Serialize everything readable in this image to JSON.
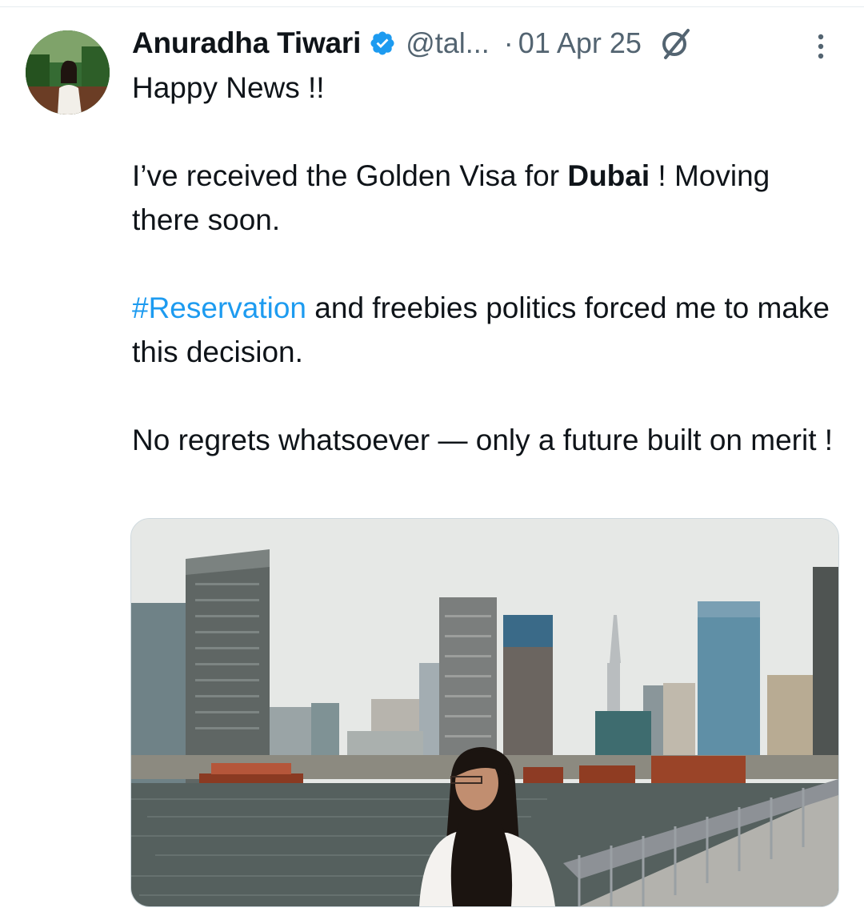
{
  "tweet": {
    "author": {
      "name": "Anuradha Tiwari",
      "handle": "@tal...",
      "verified": true,
      "avatar_icon": "profile-photo"
    },
    "separator": "·",
    "date": "01 Apr 25",
    "header_icons": [
      "verified-badge-icon",
      "grok-slash-icon",
      "more-options-icon"
    ],
    "text": {
      "line1": "Happy News !!",
      "para2_pre": "I’ve received the Golden Visa for ",
      "para2_bold": "Dubai",
      "para2_post": " ! Moving there soon.",
      "para3_hashtag": "#Reservation",
      "para3_rest": " and freebies politics forced me to make this decision.",
      "para4": "No regrets whatsoever — only a future built on merit !"
    },
    "media": {
      "type": "photo"
    }
  },
  "colors": {
    "text": "#0f1419",
    "secondary": "#536471",
    "link": "#1d9bf0",
    "verified_badge": "#1d9bf0",
    "border": "#cfd9de"
  }
}
